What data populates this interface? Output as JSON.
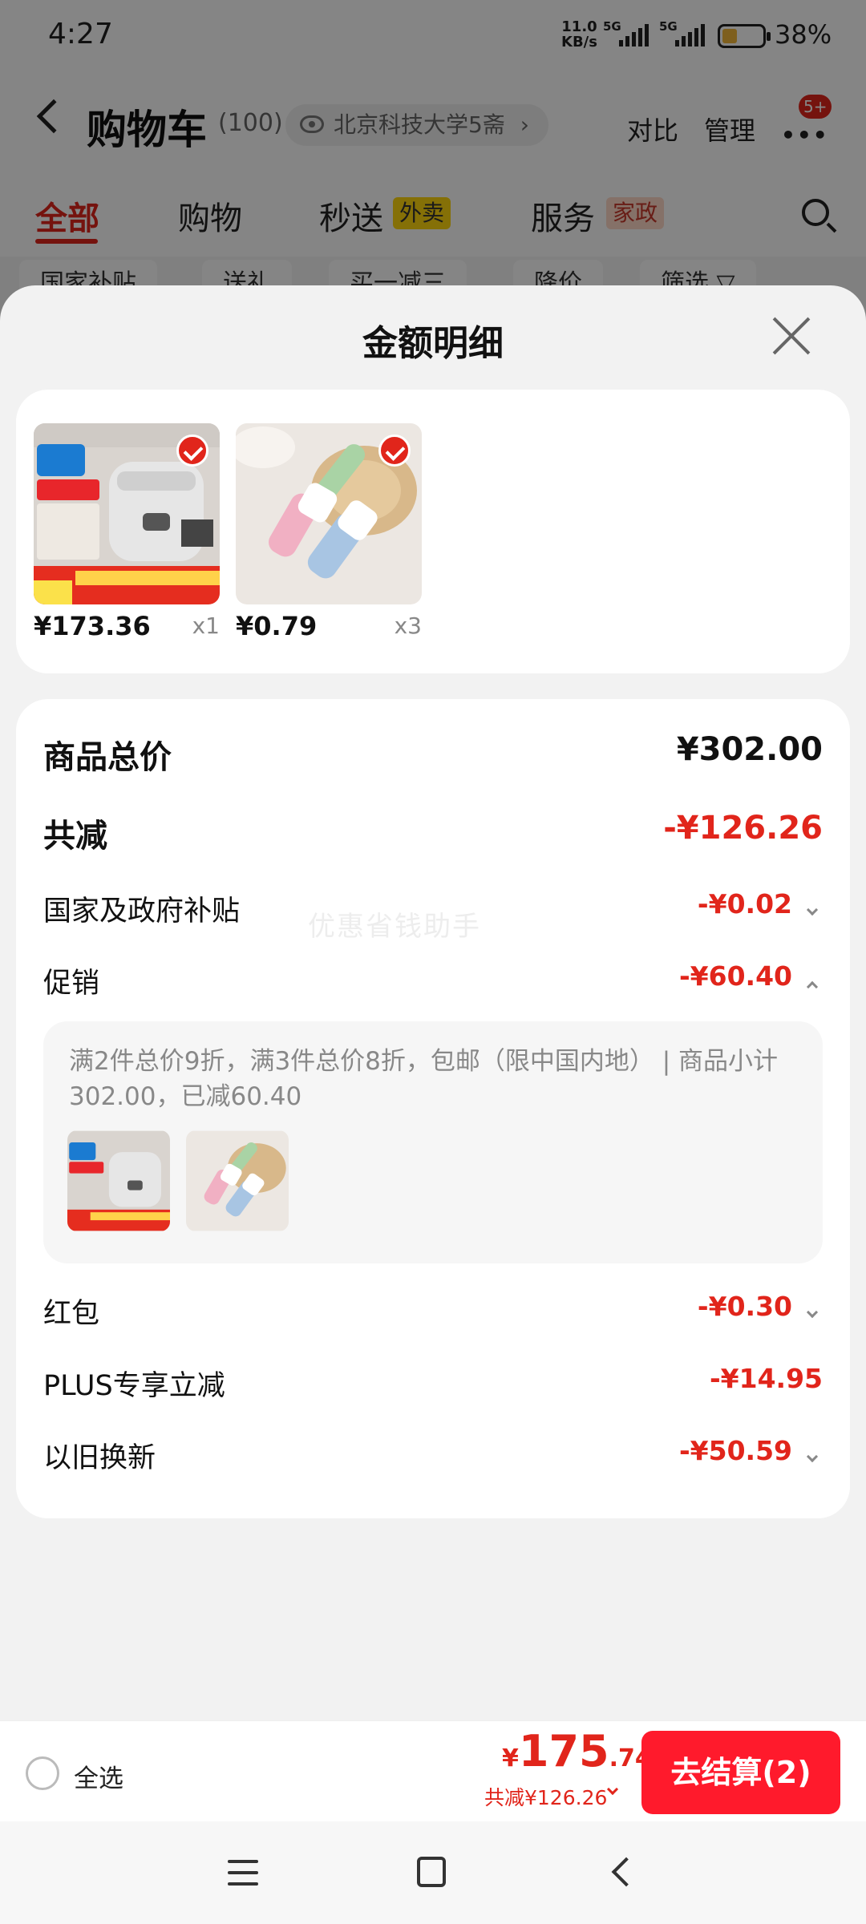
{
  "status_bar": {
    "time": "4:27",
    "net_speed_value": "11.0",
    "net_speed_unit": "KB/s",
    "signal_label_1": "5G",
    "signal_label_2": "5G",
    "battery_percent": "38%",
    "battery_color": "#f1b73a"
  },
  "cart_header": {
    "title": "购物车",
    "count": "(100)",
    "address": "北京科技大学5斋",
    "address_chevron": "›",
    "compare_label": "对比",
    "manage_label": "管理",
    "more_badge": "5+"
  },
  "cart_tabs": [
    {
      "label": "全部",
      "active": true
    },
    {
      "label": "购物",
      "active": false
    },
    {
      "label": "秒送",
      "tag": "外卖",
      "active": false
    },
    {
      "label": "服务",
      "tag": "家政",
      "active": false
    }
  ],
  "filter_chips": [
    "国家补贴",
    "送礼",
    "买一减三",
    "降价",
    "筛选 ▽"
  ],
  "sheet": {
    "title": "金额明细",
    "items": [
      {
        "price": "¥173.36",
        "qty": "x1",
        "image": "rice-cooker-image",
        "checked": true
      },
      {
        "price": "¥0.79",
        "qty": "x3",
        "image": "shoe-brush-image",
        "checked": true
      }
    ],
    "rows": {
      "total": {
        "label": "商品总价",
        "value": "¥302.00"
      },
      "reduction": {
        "label": "共减",
        "value": "-¥126.26"
      },
      "subsidy": {
        "label": "国家及政府补贴",
        "value": "-¥0.02"
      },
      "promotion": {
        "label": "促销",
        "value": "-¥60.40"
      },
      "red_packet": {
        "label": "红包",
        "value": "-¥0.30"
      },
      "plus": {
        "label": "PLUS专享立减",
        "value": "-¥14.95"
      },
      "trade_in": {
        "label": "以旧换新",
        "value": "-¥50.59"
      }
    },
    "promotion_detail": {
      "description": "满2件总价9折，满3件总价8折，包邮（限中国内地） | 商品小计302.00，已减60.40"
    },
    "watermark": "优惠省钱助手"
  },
  "checkout": {
    "select_all_label": "全选",
    "price_currency": "¥",
    "price_integer": "175",
    "price_decimal": ".74",
    "saved_text": "共减¥126.26",
    "button_label": "去结算(2)"
  },
  "colors": {
    "accent_red": "#e1251b",
    "checkout_button": "#ff1a2c",
    "sheet_background": "#f2f2f2",
    "card_background": "#ffffff"
  }
}
